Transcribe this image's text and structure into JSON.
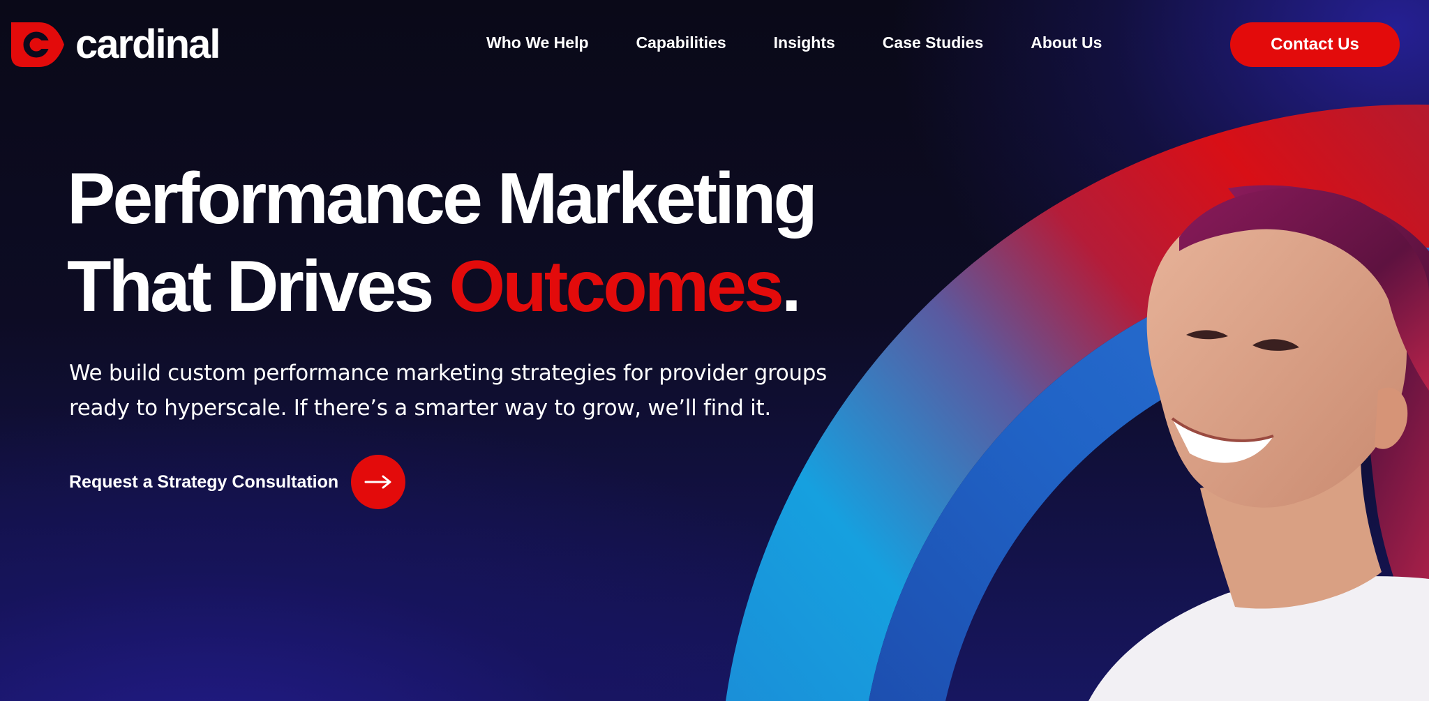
{
  "brand": {
    "name": "cardinal",
    "logo_icon": "cardinal-logo-icon",
    "accent_color": "#e30b0b"
  },
  "nav": {
    "items": [
      {
        "label": "Who We Help"
      },
      {
        "label": "Capabilities"
      },
      {
        "label": "Insights"
      },
      {
        "label": "Case Studies"
      },
      {
        "label": "About Us"
      }
    ],
    "contact_label": "Contact Us"
  },
  "hero": {
    "title_line1": "Performance Marketing",
    "title_line2_start": "That Drives ",
    "title_accent": "Outcomes",
    "title_end": ".",
    "subtitle": "We build custom performance marketing strategies for provider groups ready to hyperscale. If there’s a smarter way to grow, we’ll find it.",
    "cta_label": "Request a Strategy Consultation",
    "cta_icon": "arrow-right-icon"
  },
  "colors": {
    "background": "#0b0a1c",
    "deep_blue": "#1c1a78",
    "arc_red": "#d9101a",
    "arc_blue": "#1f63c8",
    "arc_cyan": "#1aa4e0"
  }
}
